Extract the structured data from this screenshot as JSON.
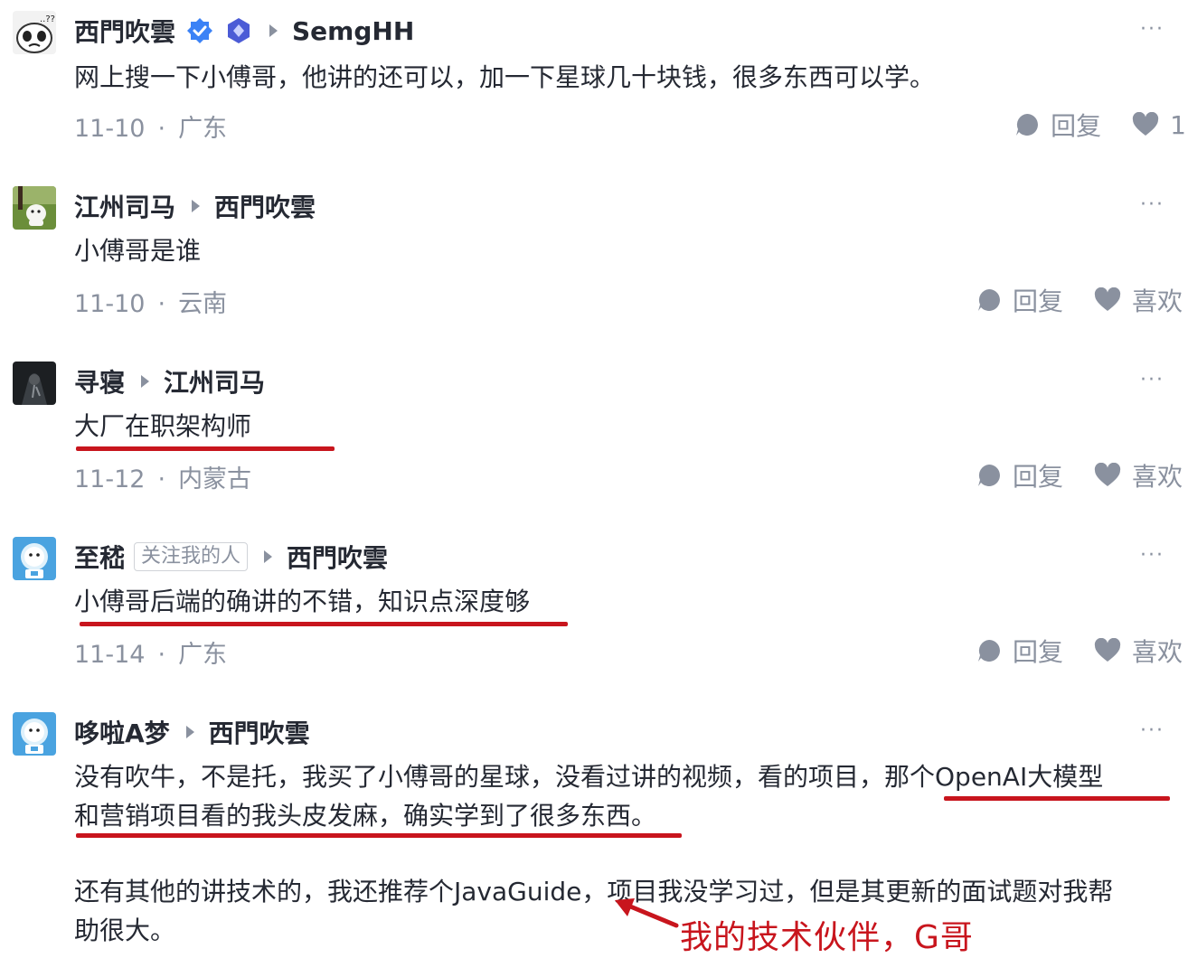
{
  "comments": [
    {
      "author": "西門吹雲",
      "reply_to": "SemgHH",
      "text": "网上搜一下小傅哥，他讲的还可以，加一下星球几十块钱，很多东西可以学。",
      "date": "11-10",
      "location": "广东",
      "reply_label": "回复",
      "like_label": "1",
      "more": "···"
    },
    {
      "author": "江州司马",
      "reply_to": "西門吹雲",
      "text": "小傅哥是谁",
      "date": "11-10",
      "location": "云南",
      "reply_label": "回复",
      "like_label": "喜欢",
      "more": "···"
    },
    {
      "author": "寻寝",
      "reply_to": "江州司马",
      "text": "大厂在职架构师",
      "date": "11-12",
      "location": "内蒙古",
      "reply_label": "回复",
      "like_label": "喜欢",
      "more": "···"
    },
    {
      "author": "至嵇",
      "tag": "关注我的人",
      "reply_to": "西門吹雲",
      "text": "小傅哥后端的确讲的不错，知识点深度够",
      "date": "11-14",
      "location": "广东",
      "reply_label": "回复",
      "like_label": "喜欢",
      "more": "···"
    },
    {
      "author": "哆啦A梦",
      "reply_to": "西門吹雲",
      "text_line1": "没有吹牛，不是托，我买了小傅哥的星球，没看过讲的视频，看的项目，那个OpenAI大模型",
      "text_line2": "和营销项目看的我头皮发麻，确实学到了很多东西。",
      "text_line3": "还有其他的讲技术的，我还推荐个JavaGuide，项目我没学习过，但是其更新的面试题对我帮",
      "text_line4": "助很大。",
      "more": "···"
    }
  ],
  "annotation": {
    "text": "我的技术伙伴，G哥"
  },
  "colors": {
    "accent_red": "#c8151d",
    "text": "#252933",
    "muted": "#8a919f",
    "verified_blue": "#3b82f6",
    "level_badge": "#4b5bd6"
  },
  "icons": {
    "verified": "verified-check-icon",
    "level": "level-diamond-icon",
    "reply": "comment-bubble-icon",
    "like": "heart-icon",
    "more": "more-dots-icon",
    "reply_arrow": "triangle-right-icon"
  }
}
